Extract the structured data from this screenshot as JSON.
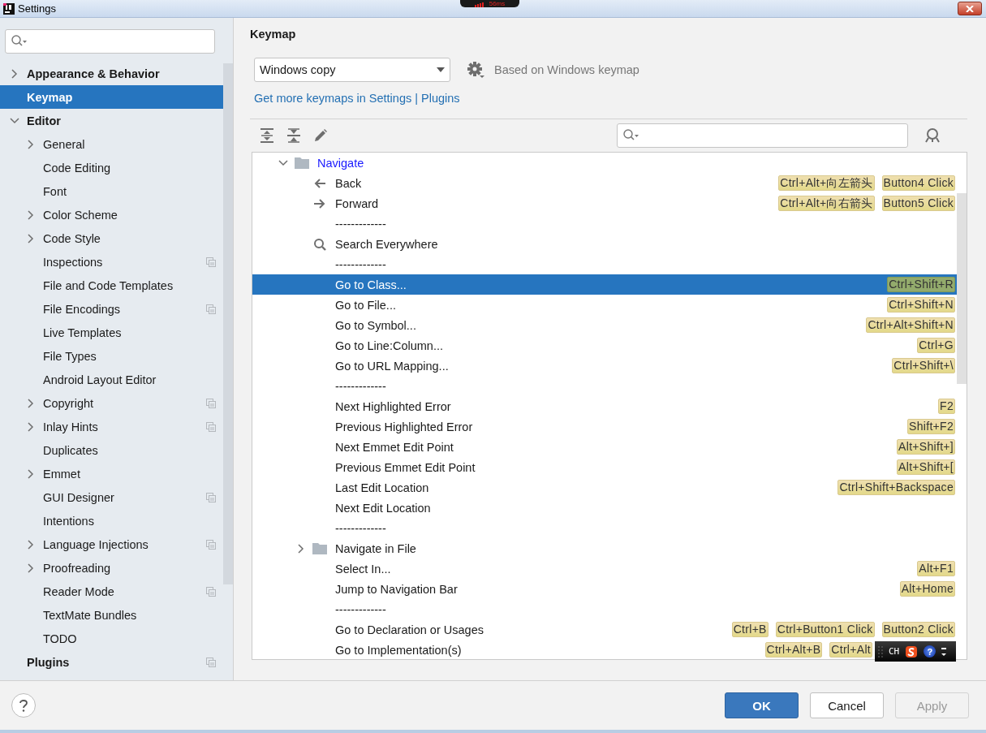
{
  "window": {
    "title": "Settings"
  },
  "latency_indicator": {
    "text": "56ms"
  },
  "sidebar": {
    "items": [
      {
        "label": "Appearance & Behavior",
        "expanded": false,
        "selected": false
      },
      {
        "label": "Keymap",
        "selected": true
      },
      {
        "label": "Editor",
        "expanded": true,
        "selected": false,
        "children": [
          {
            "label": "General",
            "expanded": false,
            "selected": false
          },
          {
            "label": "Code Editing",
            "selected": false
          },
          {
            "label": "Font",
            "selected": false
          },
          {
            "label": "Color Scheme",
            "expanded": false,
            "selected": false
          },
          {
            "label": "Code Style",
            "expanded": false,
            "selected": false
          },
          {
            "label": "Inspections",
            "selected": false,
            "project_level": true
          },
          {
            "label": "File and Code Templates",
            "selected": false
          },
          {
            "label": "File Encodings",
            "selected": false,
            "project_level": true
          },
          {
            "label": "Live Templates",
            "selected": false
          },
          {
            "label": "File Types",
            "selected": false
          },
          {
            "label": "Android Layout Editor",
            "selected": false
          },
          {
            "label": "Copyright",
            "expanded": false,
            "selected": false,
            "project_level": true
          },
          {
            "label": "Inlay Hints",
            "expanded": false,
            "selected": false,
            "project_level": true
          },
          {
            "label": "Duplicates",
            "selected": false
          },
          {
            "label": "Emmet",
            "expanded": false,
            "selected": false
          },
          {
            "label": "GUI Designer",
            "selected": false,
            "project_level": true
          },
          {
            "label": "Intentions",
            "selected": false
          },
          {
            "label": "Language Injections",
            "expanded": false,
            "selected": false,
            "project_level": true
          },
          {
            "label": "Proofreading",
            "expanded": false,
            "selected": false
          },
          {
            "label": "Reader Mode",
            "selected": false,
            "project_level": true
          },
          {
            "label": "TextMate Bundles",
            "selected": false
          },
          {
            "label": "TODO",
            "selected": false
          }
        ]
      },
      {
        "label": "Plugins",
        "selected": false,
        "project_level": true
      }
    ]
  },
  "keymap": {
    "title": "Keymap",
    "scheme": {
      "value": "Windows copy"
    },
    "based_on": "Based on Windows keymap",
    "link": "Get more keymaps in Settings | Plugins",
    "tree": [
      {
        "kind": "group",
        "label": "Navigate",
        "expanded": true,
        "modified": true,
        "selected": false,
        "children": [
          {
            "kind": "action",
            "label": "Back",
            "selected": false,
            "shortcuts": [
              "Ctrl+Alt+向左箭头",
              "Button4 Click"
            ]
          },
          {
            "kind": "action",
            "label": "Forward",
            "selected": false,
            "shortcuts": [
              "Ctrl+Alt+向右箭头",
              "Button5 Click"
            ]
          },
          {
            "kind": "separator",
            "label": "-------------",
            "selected": false
          },
          {
            "kind": "action",
            "label": "Search Everywhere",
            "selected": false
          },
          {
            "kind": "separator",
            "label": "-------------",
            "selected": false
          },
          {
            "kind": "action",
            "label": "Go to Class...",
            "selected": true,
            "shortcuts": [
              "Ctrl+Shift+R"
            ]
          },
          {
            "kind": "action",
            "label": "Go to File...",
            "selected": false,
            "shortcuts": [
              "Ctrl+Shift+N"
            ]
          },
          {
            "kind": "action",
            "label": "Go to Symbol...",
            "selected": false,
            "shortcuts": [
              "Ctrl+Alt+Shift+N"
            ]
          },
          {
            "kind": "action",
            "label": "Go to Line:Column...",
            "selected": false,
            "shortcuts": [
              "Ctrl+G"
            ]
          },
          {
            "kind": "action",
            "label": "Go to URL Mapping...",
            "selected": false,
            "shortcuts": [
              "Ctrl+Shift+\\"
            ]
          },
          {
            "kind": "separator",
            "label": "-------------",
            "selected": false
          },
          {
            "kind": "action",
            "label": "Next Highlighted Error",
            "selected": false,
            "shortcuts": [
              "F2"
            ]
          },
          {
            "kind": "action",
            "label": "Previous Highlighted Error",
            "selected": false,
            "shortcuts": [
              "Shift+F2"
            ]
          },
          {
            "kind": "action",
            "label": "Next Emmet Edit Point",
            "selected": false,
            "shortcuts": [
              "Alt+Shift+]"
            ]
          },
          {
            "kind": "action",
            "label": "Previous Emmet Edit Point",
            "selected": false,
            "shortcuts": [
              "Alt+Shift+["
            ]
          },
          {
            "kind": "action",
            "label": "Last Edit Location",
            "selected": false,
            "shortcuts": [
              "Ctrl+Shift+Backspace"
            ]
          },
          {
            "kind": "action",
            "label": "Next Edit Location",
            "selected": false
          },
          {
            "kind": "separator",
            "label": "-------------",
            "selected": false
          },
          {
            "kind": "group",
            "label": "Navigate in File",
            "expanded": false,
            "modified": false,
            "selected": false
          },
          {
            "kind": "action",
            "label": "Select In...",
            "selected": false,
            "shortcuts": [
              "Alt+F1"
            ]
          },
          {
            "kind": "action",
            "label": "Jump to Navigation Bar",
            "selected": false,
            "shortcuts": [
              "Alt+Home"
            ]
          },
          {
            "kind": "separator",
            "label": "-------------",
            "selected": false
          },
          {
            "kind": "action",
            "label": "Go to Declaration or Usages",
            "selected": false,
            "shortcuts": [
              "Ctrl+B",
              "Ctrl+Button1 Click",
              "Button2 Click"
            ]
          },
          {
            "kind": "action",
            "label": "Go to Implementation(s)",
            "selected": false,
            "shortcuts": [
              "Ctrl+Alt+B",
              "Ctrl+Alt"
            ]
          }
        ]
      }
    ]
  },
  "buttons": [
    {
      "label": "OK",
      "kind": "primary",
      "disabled": false
    },
    {
      "label": "Cancel",
      "kind": "normal",
      "disabled": false
    },
    {
      "label": "Apply",
      "kind": "normal",
      "disabled": true
    }
  ],
  "ime_bar": {
    "language": "CH",
    "help": "?"
  }
}
